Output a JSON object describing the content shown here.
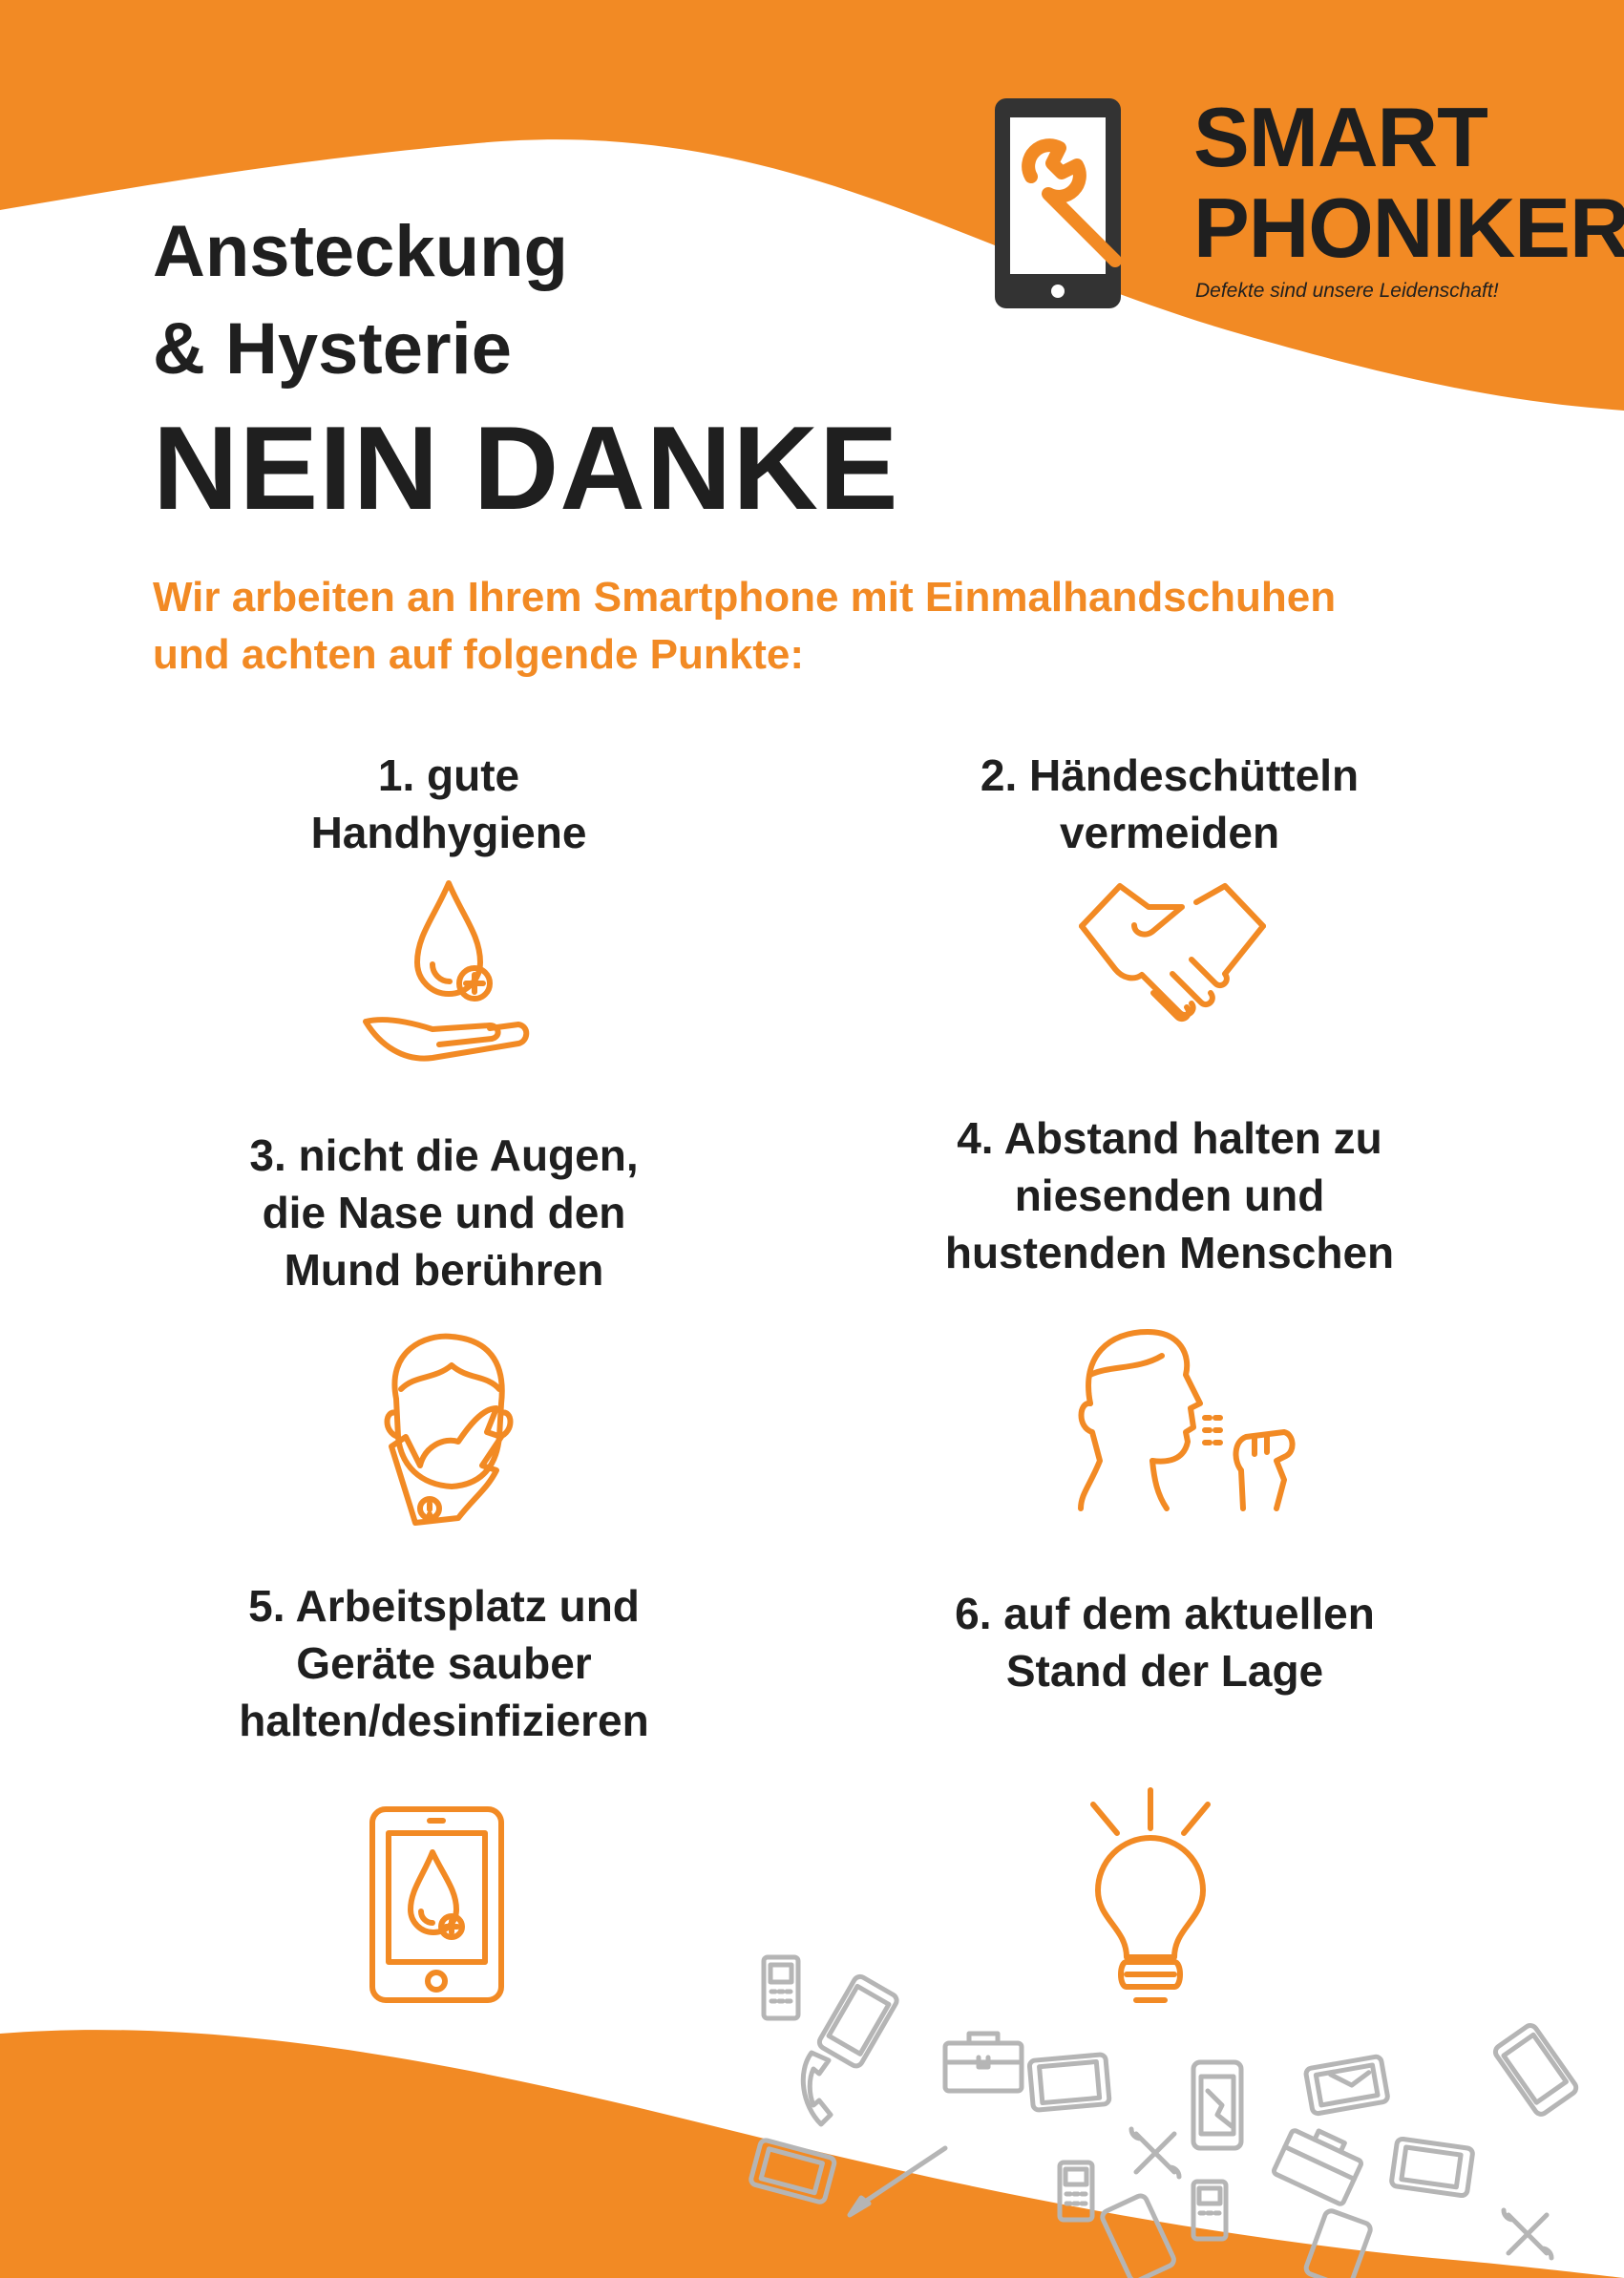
{
  "header": {
    "title_line1": "Ansteckung",
    "title_line2": "& Hysterie",
    "title_line3": "NEIN DANKE",
    "intro_line1": "Wir arbeiten an Ihrem Smartphone mit Einmalhandschuhen",
    "intro_line2": "und achten auf folgende Punkte:"
  },
  "logo": {
    "line1": "SMART",
    "line2": "PHONIKER",
    "tagline": "Defekte sind unsere Leidenschaft!",
    "icon": "tablet-wrench-icon"
  },
  "items": [
    {
      "lines": [
        "1. gute",
        "Handhygiene"
      ],
      "icon": "hand-drop-icon"
    },
    {
      "lines": [
        "2. Händeschütteln",
        "vermeiden"
      ],
      "icon": "handshake-icon"
    },
    {
      "lines": [
        "3. nicht die Augen,",
        "die Nase und den",
        "Mund berühren"
      ],
      "icon": "face-touch-icon"
    },
    {
      "lines": [
        "4. Abstand halten zu",
        "niesenden und",
        "hustenden Menschen"
      ],
      "icon": "cough-icon"
    },
    {
      "lines": [
        "5. Arbeitsplatz und",
        "Geräte sauber",
        "halten/desinfizieren"
      ],
      "icon": "phone-disinfect-icon"
    },
    {
      "lines": [
        "6. auf dem aktuellen",
        "Stand der Lage"
      ],
      "icon": "lightbulb-icon"
    }
  ],
  "colors": {
    "accent": "#f28a24",
    "text": "#1f1f1f",
    "decoration": "#b5b5b5",
    "background": "#ffffff"
  }
}
